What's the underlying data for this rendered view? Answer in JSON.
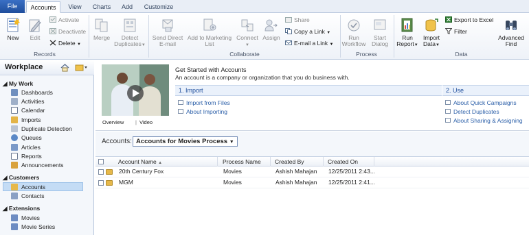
{
  "tabs": {
    "file": "File",
    "accounts": "Accounts",
    "view": "View",
    "charts": "Charts",
    "add": "Add",
    "customize": "Customize"
  },
  "ribbon": {
    "records": {
      "label": "Records",
      "new": "New",
      "edit": "Edit",
      "activate": "Activate",
      "deactivate": "Deactivate",
      "delete": "Delete"
    },
    "merge": "Merge",
    "detect_duplicates": [
      "Detect",
      "Duplicates"
    ],
    "collaborate": {
      "label": "Collaborate",
      "send_direct_email": [
        "Send Direct",
        "E-mail"
      ],
      "add_to_marketing_list": [
        "Add to Marketing",
        "List"
      ],
      "connect": "Connect",
      "assign": "Assign",
      "share": "Share",
      "copy_a_link": "Copy a Link",
      "email_a_link": "E-mail a Link"
    },
    "process": {
      "label": "Process",
      "run_workflow": [
        "Run",
        "Workflow"
      ],
      "start_dialog": [
        "Start",
        "Dialog"
      ]
    },
    "data": {
      "label": "Data",
      "run_report": [
        "Run",
        "Report"
      ],
      "import_data": [
        "Import",
        "Data"
      ],
      "export_to_excel": "Export to Excel",
      "filter": "Filter",
      "advanced_find": [
        "Advanced",
        "Find"
      ]
    }
  },
  "sidebar": {
    "title": "Workplace",
    "groups": {
      "my_work": "My Work",
      "customers": "Customers",
      "extensions": "Extensions"
    },
    "my_work_items": [
      "Dashboards",
      "Activities",
      "Calendar",
      "Imports",
      "Duplicate Detection",
      "Queues",
      "Articles",
      "Reports",
      "Announcements"
    ],
    "customer_items": [
      "Accounts",
      "Contacts"
    ],
    "extension_items": [
      "Movies",
      "Movie Series"
    ]
  },
  "get_started": {
    "title": "Get Started with Accounts",
    "subtitle": "An account is a company or organization that you do business with.",
    "video_overview": "Overview",
    "video_sep": "|",
    "video_label": "Video",
    "import": {
      "heading": "1. Import",
      "links": [
        "Import from Files",
        "About Importing"
      ]
    },
    "use": {
      "heading": "2. Use",
      "links": [
        "About Quick Campaigns",
        "Detect Duplicates",
        "About Sharing & Assigning"
      ]
    }
  },
  "grid": {
    "view_label": "Accounts:",
    "view_name": "Accounts for Movies Process",
    "columns": [
      "Account Name",
      "Process Name",
      "Created By",
      "Created On"
    ],
    "rows": [
      [
        "20th Century Fox",
        "Movies",
        "Ashish Mahajan",
        "12/25/2011 2:43..."
      ],
      [
        "MGM",
        "Movies",
        "Ashish Mahajan",
        "12/25/2011 2:41..."
      ]
    ]
  },
  "colors": {
    "accent": "#1f4e9c",
    "link": "#2a5ea8",
    "selected": "#c4dcf5"
  }
}
